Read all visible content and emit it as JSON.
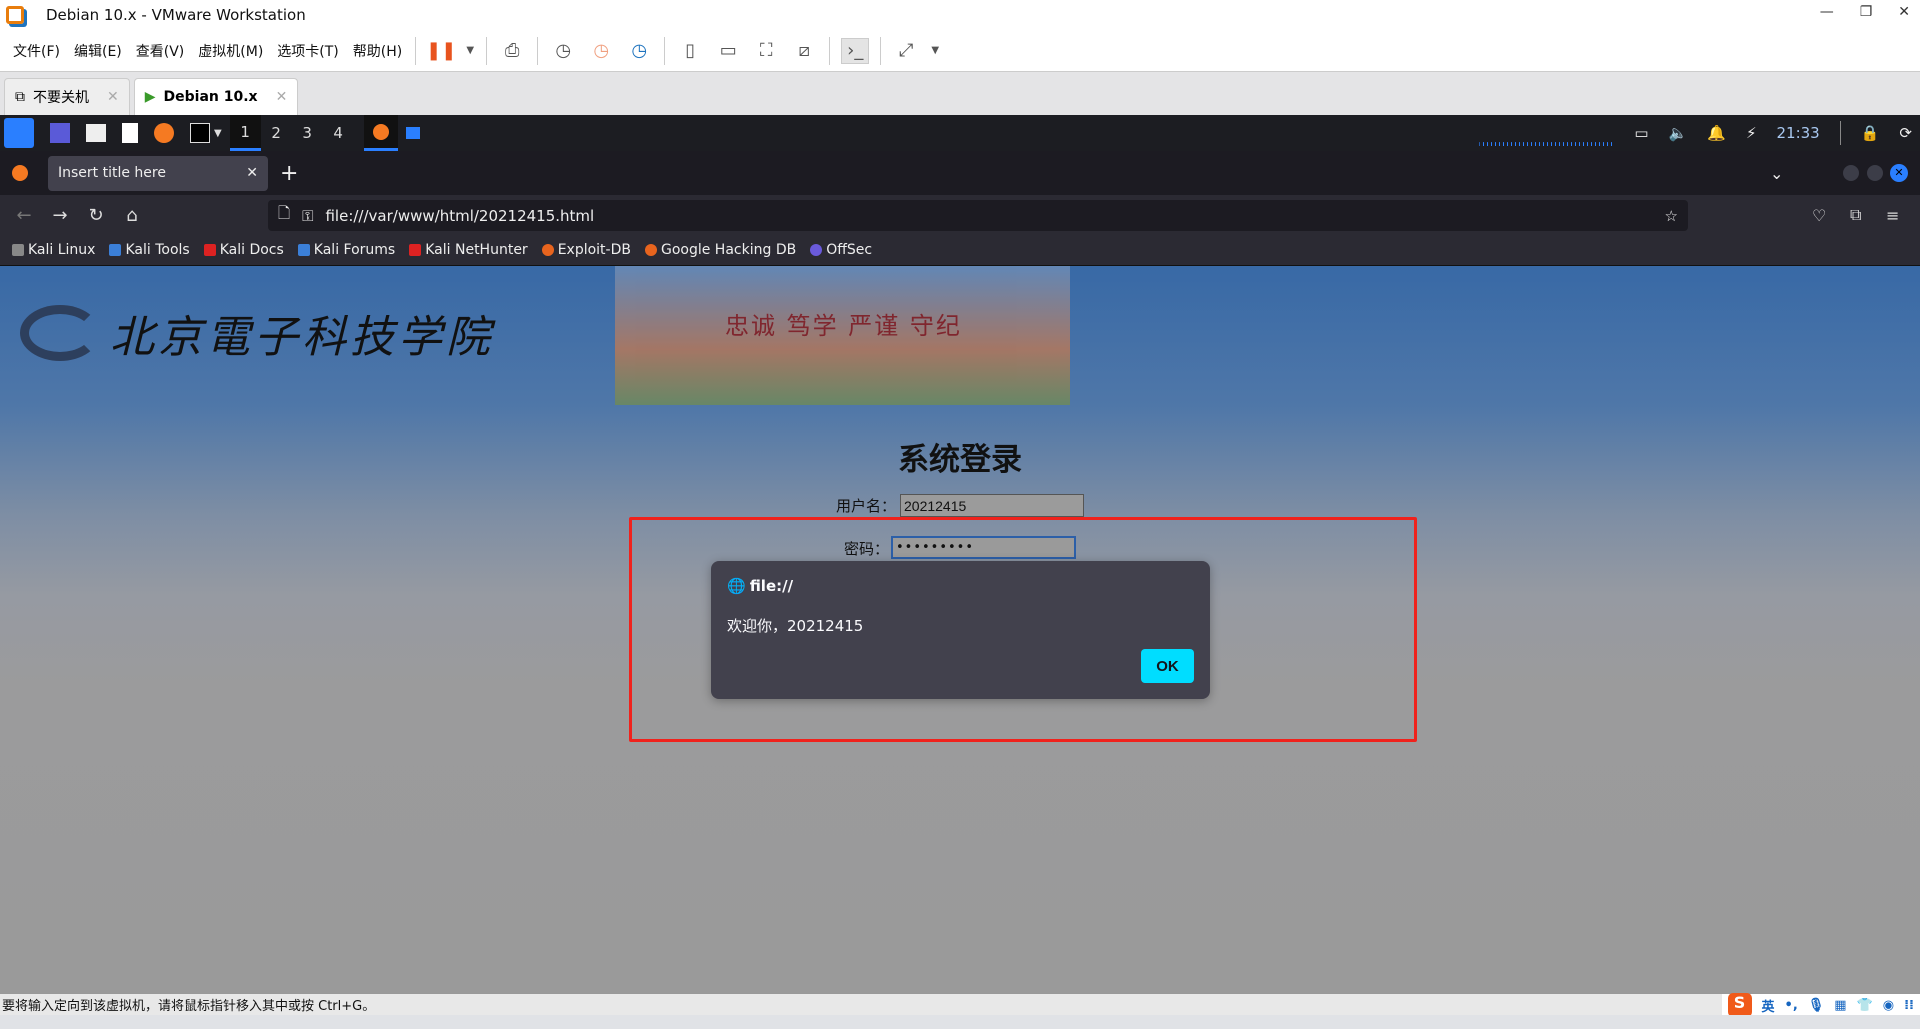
{
  "window": {
    "title": "Debian 10.x - VMware Workstation"
  },
  "menu": [
    "文件(F)",
    "编辑(E)",
    "查看(V)",
    "虚拟机(M)",
    "选项卡(T)",
    "帮助(H)"
  ],
  "vm_tabs": [
    {
      "label": "不要关机",
      "active": false
    },
    {
      "label": "Debian 10.x",
      "active": true
    }
  ],
  "kali_panel": {
    "workspaces": [
      "1",
      "2",
      "3",
      "4"
    ],
    "clock": "21:33"
  },
  "browser": {
    "tab_title": "Insert title here",
    "url": "file:///var/www/html/20212415.html",
    "bookmarks": [
      "Kali Linux",
      "Kali Tools",
      "Kali Docs",
      "Kali Forums",
      "Kali NetHunter",
      "Exploit-DB",
      "Google Hacking DB",
      "OffSec"
    ]
  },
  "page": {
    "school_name": "北京電子科技学院",
    "motto": "忠诚 笃学 严谨 守纪",
    "title": "系统登录",
    "username_label": "用户名：",
    "username_value": "20212415",
    "password_label": "密码：",
    "password_value": "•••••••••"
  },
  "dialog": {
    "origin": "file://",
    "message": "欢迎你，20212415",
    "ok_label": "OK"
  },
  "statusbar": {
    "text": "要将输入定向到该虚拟机，请将鼠标指针移入其中或按 Ctrl+G。",
    "ime_label": "英"
  },
  "colors": {
    "highlight_box": "#f0221c",
    "ok_button": "#00ddff",
    "dialog_bg": "#42414d"
  }
}
